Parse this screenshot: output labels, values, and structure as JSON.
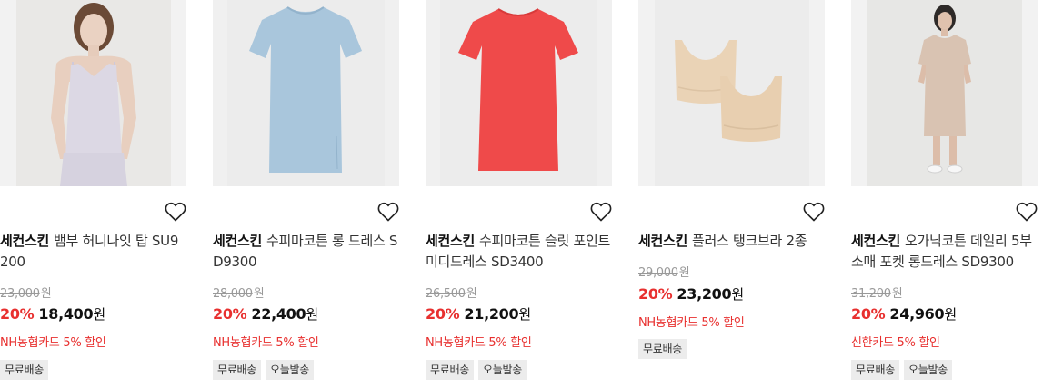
{
  "heart_icon": "heart-outline-icon",
  "products": [
    {
      "brand": "세컨스킨",
      "name": "뱀부 허니나잇 탑 SU9200",
      "original_price": "23,000",
      "discount_rate": "20%",
      "sale_price": "18,400",
      "currency": "원",
      "card_benefit": "NH농협카드 5% 할인",
      "badges": [
        "무료배송"
      ]
    },
    {
      "brand": "세컨스킨",
      "name": "수피마코튼 롱 드레스 SD9300",
      "original_price": "28,000",
      "discount_rate": "20%",
      "sale_price": "22,400",
      "currency": "원",
      "card_benefit": "NH농협카드 5% 할인",
      "badges": [
        "무료배송",
        "오늘발송"
      ]
    },
    {
      "brand": "세컨스킨",
      "name": "수피마코튼 슬릿 포인트 미디드레스 SD3400",
      "original_price": "26,500",
      "discount_rate": "20%",
      "sale_price": "21,200",
      "currency": "원",
      "card_benefit": "NH농협카드 5% 할인",
      "badges": [
        "무료배송",
        "오늘발송"
      ]
    },
    {
      "brand": "세컨스킨",
      "name": "플러스 탱크브라 2종",
      "original_price": "29,000",
      "discount_rate": "20%",
      "sale_price": "23,200",
      "currency": "원",
      "card_benefit": "NH농협카드 5% 할인",
      "badges": [
        "무료배송"
      ]
    },
    {
      "brand": "세컨스킨",
      "name": "오가닉코튼 데일리 5부소매 포켓 롱드레스 SD9300",
      "original_price": "31,200",
      "discount_rate": "20%",
      "sale_price": "24,960",
      "currency": "원",
      "card_benefit": "신한카드 5% 할인",
      "badges": [
        "무료배송",
        "오늘발송"
      ]
    }
  ]
}
